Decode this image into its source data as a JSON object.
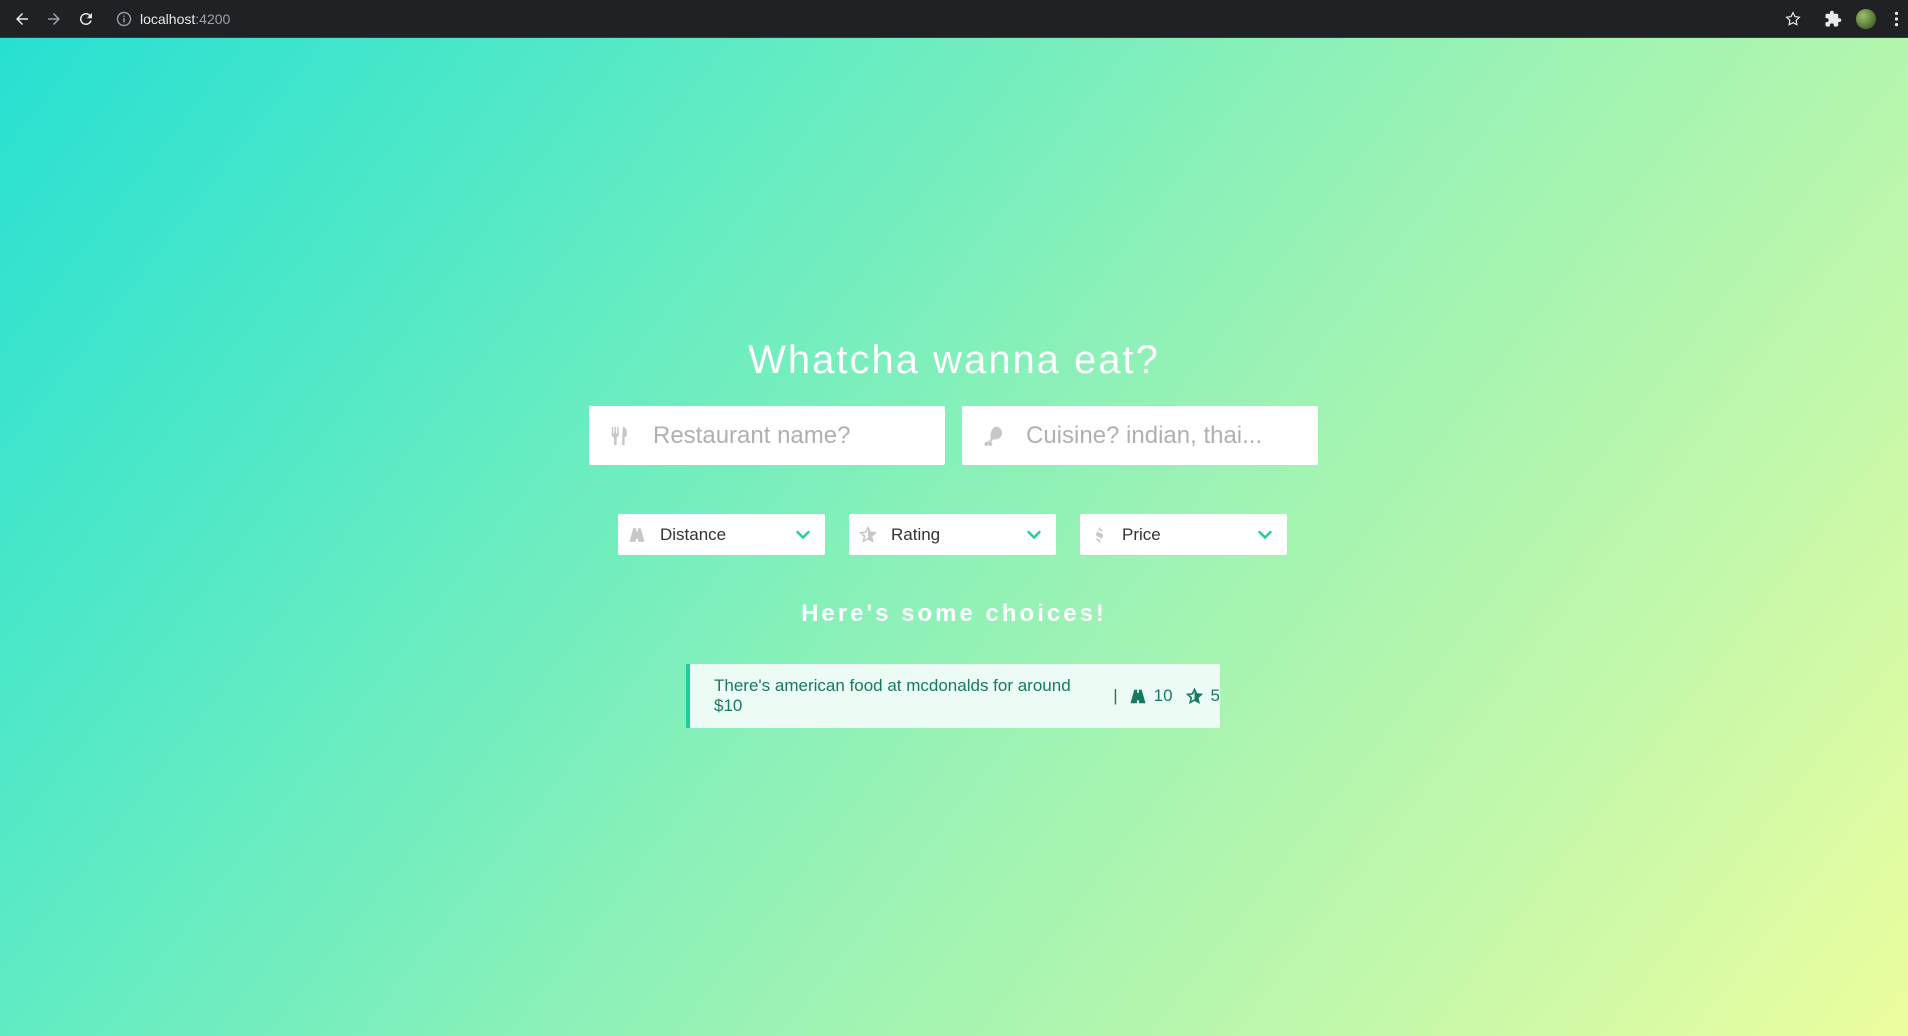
{
  "browser": {
    "url_host": "localhost",
    "url_port": ":4200",
    "icons": [
      "back-icon",
      "forward-icon",
      "reload-icon",
      "info-icon",
      "bookmark-star-icon",
      "extensions-icon",
      "profile-avatar",
      "menu-icon"
    ]
  },
  "app": {
    "title": "Whatcha wanna eat?",
    "search": {
      "restaurant_placeholder": "Restaurant name?",
      "cuisine_placeholder": "Cuisine? indian, thai..."
    },
    "filters": [
      {
        "label": "Distance",
        "icon": "road-icon"
      },
      {
        "label": "Rating",
        "icon": "star-icon"
      },
      {
        "label": "Price",
        "icon": "dollar-icon"
      }
    ],
    "results_heading": "Here's some choices!",
    "results": [
      {
        "text": "There's american food at mcdonalds for around $10",
        "separator": "|",
        "distance": "10",
        "rating": "5"
      }
    ]
  },
  "colors": {
    "accent": "#1fcf9e",
    "result_text": "#17795f",
    "gradient_start": "#27e0d2",
    "gradient_end": "#ecfd9e"
  }
}
